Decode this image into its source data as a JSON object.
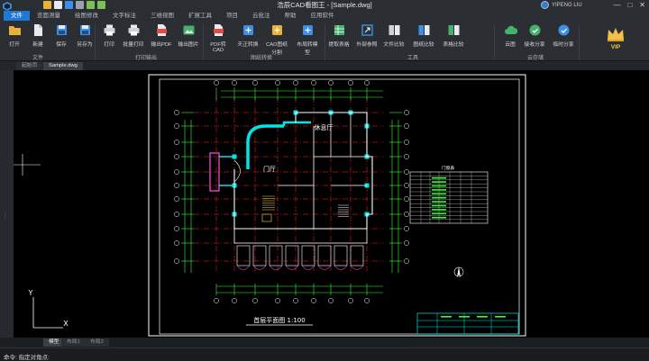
{
  "window": {
    "title": "浩辰CAD看图王 - [Sample.dwg]",
    "user_name": "YIPENG LIU",
    "controls": [
      "—",
      "□",
      "✕"
    ]
  },
  "menu_tabs": [
    {
      "label": "文件",
      "active": true
    },
    {
      "label": "览面测量",
      "active": false
    },
    {
      "label": "绘图修改",
      "active": false
    },
    {
      "label": "文字标注",
      "active": false
    },
    {
      "label": "三维视图",
      "active": false
    },
    {
      "label": "扩展工具",
      "active": false
    },
    {
      "label": "项目",
      "active": false
    },
    {
      "label": "云批注",
      "active": false
    },
    {
      "label": "帮助",
      "active": false
    },
    {
      "label": "应用软件",
      "active": false
    }
  ],
  "ribbon": {
    "buttons": [
      {
        "label": "打开",
        "icon": "folder-open-icon",
        "color": "#e8b23a"
      },
      {
        "label": "新建",
        "icon": "new-file-icon",
        "color": "#e7eaee"
      },
      {
        "label": "保存",
        "icon": "save-icon",
        "color": "#3d8ee6"
      },
      {
        "label": "另存为",
        "icon": "save-as-icon",
        "color": "#3d8ee6"
      },
      {
        "label": "打印",
        "icon": "print-icon",
        "color": "#cfd3d8"
      },
      {
        "label": "批量打印",
        "icon": "batch-print-icon",
        "color": "#cfd3d8"
      },
      {
        "label": "输出PDF",
        "icon": "pdf-export-icon",
        "color": "#e04d3c"
      },
      {
        "label": "输出图片",
        "icon": "image-export-icon",
        "color": "#45b26b"
      },
      {
        "label": "PDF转CAD",
        "icon": "pdf-to-cad-icon",
        "color": "#e04d3c"
      },
      {
        "label": "天正转换",
        "icon": "tangent-convert-icon",
        "color": "#3d8ee6"
      },
      {
        "label": "CAD图纸分割",
        "icon": "split-drawing-icon",
        "color": "#e8b23a"
      },
      {
        "label": "布局转模型",
        "icon": "layout-to-model-icon",
        "color": "#3d8ee6"
      },
      {
        "label": "提取表格",
        "icon": "extract-table-icon",
        "color": "#45b26b"
      },
      {
        "label": "外部参照",
        "icon": "xref-icon",
        "color": "#3d8ee6"
      },
      {
        "label": "文件比较",
        "icon": "file-compare-icon",
        "color": "#cfd3d8"
      },
      {
        "label": "图纸比较",
        "icon": "drawing-compare-icon",
        "color": "#3d8ee6"
      },
      {
        "label": "表格比较",
        "icon": "table-compare-icon",
        "color": "#45b26b"
      },
      {
        "label": "云图",
        "icon": "cloud-icon",
        "color": "#45b26b"
      },
      {
        "label": "接收分享",
        "icon": "receive-share-icon",
        "color": "#45b26b"
      },
      {
        "label": "临时分享",
        "icon": "temp-share-icon",
        "color": "#3d8ee6"
      }
    ],
    "groups": [
      "文件",
      "打印输出",
      "图纸转换",
      "工具",
      "云存储"
    ],
    "vip_label": "VIP"
  },
  "doc_tabs": [
    {
      "label": "起始页",
      "active": false
    },
    {
      "label": "Sample.dwg",
      "active": true
    }
  ],
  "drawing": {
    "room_labels": [
      "休息厅",
      "门厅"
    ],
    "title": "首层平面图 1:100",
    "table_title": "门窗表",
    "axis_y": "Y",
    "axis_x": "X"
  },
  "layout_tabs": [
    {
      "label": "模型",
      "active": true
    },
    {
      "label": "布局1",
      "active": false
    },
    {
      "label": "布局2",
      "active": false
    }
  ],
  "command": {
    "prompt": "命令: 指定对角点:"
  },
  "colors": {
    "accent": "#1f78d1",
    "wall": "#ffffff",
    "grid": "#ff2a2a",
    "annotation": "#00e5e5",
    "dimension": "#33ff33",
    "paper_border": "#ffffff"
  }
}
